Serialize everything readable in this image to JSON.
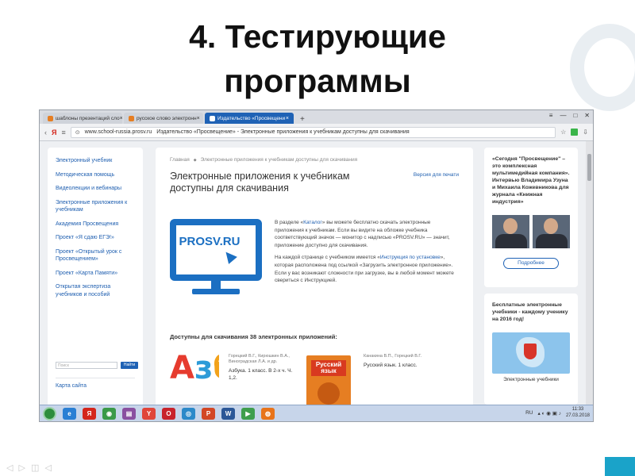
{
  "slide": {
    "title_line1": "4. Тестирующие",
    "title_line2": "программы"
  },
  "browser": {
    "tabs": [
      {
        "label": "шаблоны презентаций сло",
        "active": false
      },
      {
        "label": "русское слово электронн",
        "active": false
      },
      {
        "label": "Издательство «Просвещени",
        "active": true
      }
    ],
    "new_tab": "+",
    "window_controls": [
      "≡",
      "—",
      "□",
      "✕"
    ],
    "yandex_logo": "Я",
    "url_host": "www.school-russia.prosv.ru",
    "url_page_title": "Издательство «Просвещение» - Электронные приложения к учебникам доступны для скачивания"
  },
  "left_nav": {
    "items": [
      "Электронный учебник",
      "Методическая помощь",
      "Видеолекции и вебинары",
      "Электронные приложения к учебникам",
      "Академия Просвещения",
      "Проект «Я сдаю ЕГЭ!»",
      "Проект «Открытый урок с Просвещением»",
      "Проект «Карта Памяти»",
      "Открытая экспертиза учебников и пособий"
    ],
    "search_placeholder": "Поиск",
    "search_button": "Найти",
    "sitemap": "Карта сайта"
  },
  "main": {
    "breadcrumb_home": "Главная",
    "breadcrumb_sep": "◆",
    "breadcrumb_current": "Электронные приложения к учебникам доступны для скачивания",
    "heading": "Электронные приложения к учебникам доступны для скачивания",
    "print_version": "Версия для печати",
    "monitor_text": "PROSV.RU",
    "para1_a": "В разделе «",
    "para1_link": "Каталог",
    "para1_b": "» вы можете бесплатно скачать электронные приложения к учебникам. Если вы видите на обложке учебника соответствующий значок — монитор с надписью «PROSV.RU» — значит, приложение доступно для скачивания.",
    "para2_a": "На каждой странице с учебником имеется «",
    "para2_link": "Инструкция по установке",
    "para2_b": "», которая расположена под ссылкой «Загрузить электронное приложение». Если у вас возникают сложности при загрузке, вы в любой момент можете свериться с Инструкцией.",
    "available_heading": "Доступны для скачивания 38 электронных приложений:",
    "book1": {
      "cover_letters": [
        "А",
        "з",
        "б"
      ],
      "authors": "Горецкий В.Г., Кирюшкин В.А., Виноградская Л.А. и др.",
      "title": "Азбука. 1 класс. В 2-х ч. Ч. 1,2."
    },
    "book2": {
      "cover_label": "Русский язык",
      "authors": "Канакина В.П., Горецкий В.Г.",
      "title": "Русский язык. 1 класс."
    }
  },
  "right": {
    "promo1": "«Сегодня \"Просвещение\" – это комплексная мультимедийная компания». Интервью Владимира Узуна и Михаила Кожевникова для журнала «Книжная индустрия»",
    "promo1_button": "Подробнее",
    "promo2": "Бесплатные электронные учебники - каждому ученику на 2016 год!",
    "promo2_caption": "Электронные учебники"
  },
  "taskbar": {
    "lang": "RU",
    "time": "11:33",
    "date": "27.03.2018",
    "apps": [
      {
        "name": "ie",
        "glyph": "e",
        "color": "#2a7fd4"
      },
      {
        "name": "yandex",
        "glyph": "Я",
        "color": "#d4261c"
      },
      {
        "name": "chrome",
        "glyph": "◉",
        "color": "#3a9a48"
      },
      {
        "name": "winrar",
        "glyph": "▤",
        "color": "#8a4fa0"
      },
      {
        "name": "yandex-browser",
        "glyph": "Y",
        "color": "#e0453a"
      },
      {
        "name": "opera",
        "glyph": "O",
        "color": "#c8232c"
      },
      {
        "name": "app-blue",
        "glyph": "◎",
        "color": "#2b89c9"
      },
      {
        "name": "powerpoint",
        "glyph": "P",
        "color": "#d24726"
      },
      {
        "name": "word",
        "glyph": "W",
        "color": "#2b5797"
      },
      {
        "name": "media-player",
        "glyph": "▶",
        "color": "#3f9e4d"
      },
      {
        "name": "firefox",
        "glyph": "◍",
        "color": "#e8741b"
      }
    ]
  }
}
